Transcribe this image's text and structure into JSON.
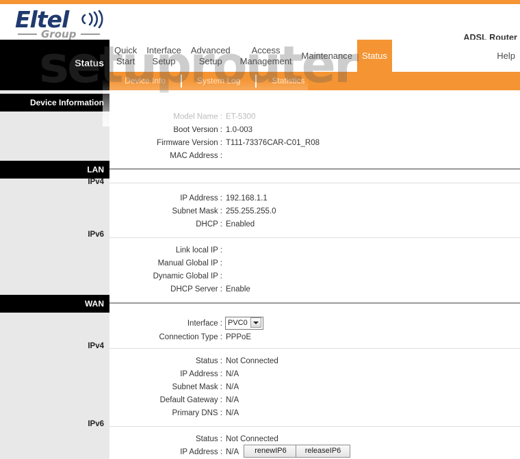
{
  "header": {
    "product_name": "ADSL Router",
    "logo_text": "Eltel",
    "logo_subtext": "Group",
    "accent_color": "#F59432",
    "logo_color": "#1F3A6E"
  },
  "watermark": {
    "text": "setuprouter"
  },
  "nav": {
    "current_page_label": "Status",
    "items": [
      {
        "label": "Quick\nStart",
        "active": false
      },
      {
        "label": "Interface\nSetup",
        "active": false
      },
      {
        "label": "Advanced\nSetup",
        "active": false
      },
      {
        "label": "Access\nManagement",
        "active": false
      },
      {
        "label": "Maintenance",
        "active": false
      },
      {
        "label": "Status",
        "active": true
      },
      {
        "label": "Help",
        "active": false
      }
    ]
  },
  "subnav": {
    "items": [
      {
        "label": "Device Info",
        "active": true
      },
      {
        "label": "System Log",
        "active": false
      },
      {
        "label": "Statistics",
        "active": false
      }
    ]
  },
  "sidebar": {
    "sections": [
      {
        "label": "Device Information",
        "type": "head"
      },
      {
        "label": "LAN",
        "type": "head"
      },
      {
        "label": "IPv4",
        "type": "sub"
      },
      {
        "label": "IPv6",
        "type": "sub"
      },
      {
        "label": "WAN",
        "type": "head"
      },
      {
        "label": "IPv4",
        "type": "sub"
      },
      {
        "label": "IPv6",
        "type": "sub"
      }
    ]
  },
  "device_information": {
    "model_name_label": "Model Name :",
    "model_name_value": "ET-5300",
    "boot_version_label": "Boot Version :",
    "boot_version_value": "1.0-003",
    "firmware_version_label": "Firmware Version :",
    "firmware_version_value": "T111-73376CAR-C01_R08",
    "mac_address_label": "MAC Address :",
    "mac_address_value": ""
  },
  "lan_ipv4": {
    "ip_address_label": "IP Address :",
    "ip_address_value": "192.168.1.1",
    "subnet_mask_label": "Subnet Mask :",
    "subnet_mask_value": "255.255.255.0",
    "dhcp_label": "DHCP :",
    "dhcp_value": "Enabled"
  },
  "lan_ipv6": {
    "link_local_ip_label": "Link local IP :",
    "link_local_ip_value": "",
    "manual_global_ip_label": "Manual Global IP :",
    "manual_global_ip_value": "",
    "dynamic_global_ip_label": "Dynamic Global IP :",
    "dynamic_global_ip_value": "",
    "dhcp_server_label": "DHCP Server :",
    "dhcp_server_value": "Enable"
  },
  "wan": {
    "interface_label": "Interface :",
    "interface_value": "PVC0",
    "interface_options": [
      "PVC0"
    ],
    "connection_type_label": "Connection Type :",
    "connection_type_value": "PPPoE"
  },
  "wan_ipv4": {
    "status_label": "Status :",
    "status_value": "Not Connected",
    "ip_address_label": "IP Address :",
    "ip_address_value": "N/A",
    "subnet_mask_label": "Subnet Mask :",
    "subnet_mask_value": "N/A",
    "default_gateway_label": "Default Gateway :",
    "default_gateway_value": "N/A",
    "primary_dns_label": "Primary DNS :",
    "primary_dns_value": "N/A"
  },
  "wan_ipv6": {
    "status_label": "Status :",
    "status_value": "Not Connected",
    "ip_address_label": "IP Address :",
    "ip_address_value": "N/A",
    "renew_button_label": "renewIP6",
    "release_button_label": "releaseIP6"
  }
}
